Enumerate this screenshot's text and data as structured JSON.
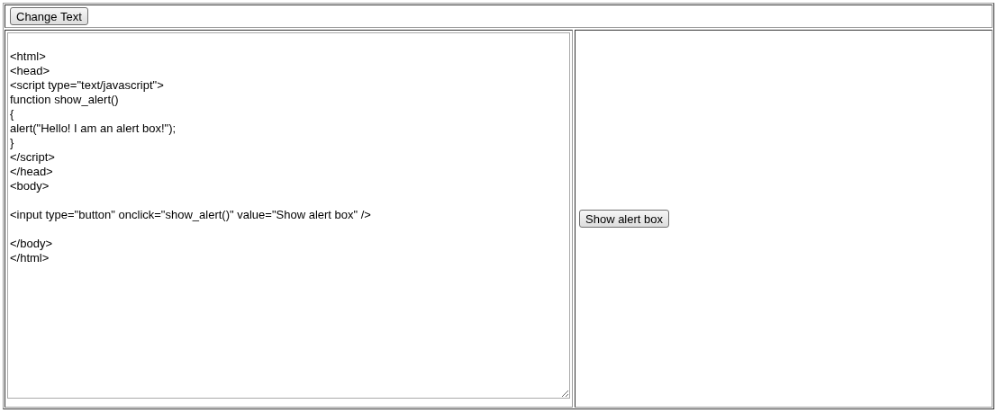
{
  "toolbar": {
    "button": "Change Text"
  },
  "editor": {
    "blocks": [
      [
        "<html>",
        "<head>",
        "<script type=\"text/javascript\">",
        "function show_alert()",
        "{",
        "alert(\"Hello! I am an alert box!\");",
        "}",
        "</script>",
        "</head>",
        "<body>"
      ],
      [
        "<input type=\"button\" onclick=\"show_alert()\" value=\"Show alert box\" />"
      ],
      [
        "</body>",
        "</html>"
      ]
    ]
  },
  "preview": {
    "button": "Show alert box"
  }
}
